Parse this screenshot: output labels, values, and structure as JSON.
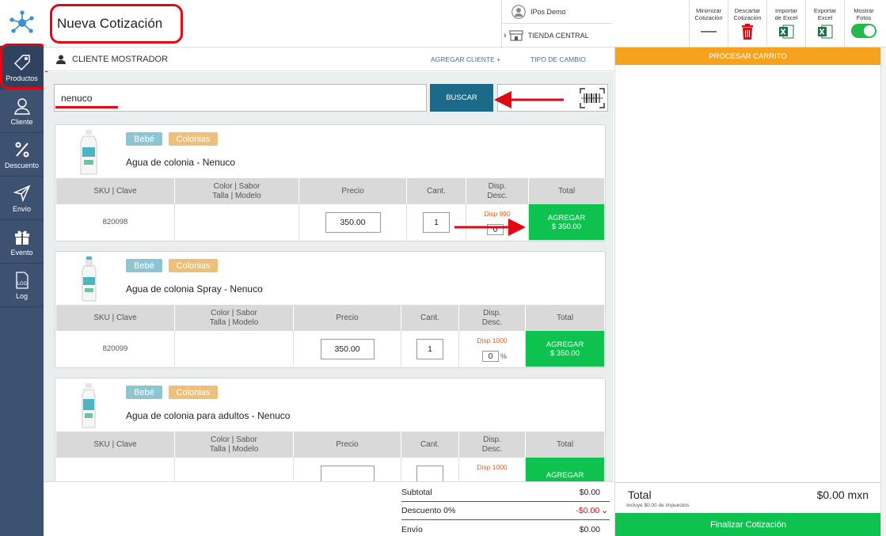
{
  "header": {
    "title": "Nueva Cotización",
    "user_name": "IPos Demo",
    "store_name": "TIENDA CENTRAL",
    "tools": [
      {
        "label_l1": "Minimizar",
        "label_l2": "Cotización"
      },
      {
        "label_l1": "Descartar",
        "label_l2": "Cotización"
      },
      {
        "label_l1": "Importar",
        "label_l2": "de Excel"
      },
      {
        "label_l1": "Exportar",
        "label_l2": "Excel"
      },
      {
        "label_l1": "Mostrar",
        "label_l2": "Fotos"
      }
    ]
  },
  "sidebar": {
    "items": [
      {
        "label": "Productos",
        "icon": "tag-icon"
      },
      {
        "label": "Cliente",
        "icon": "user-icon"
      },
      {
        "label": "Descuento",
        "icon": "percent-icon"
      },
      {
        "label": "Envío",
        "icon": "send-icon"
      },
      {
        "label": "Evento",
        "icon": "gift-icon"
      },
      {
        "label": "Log",
        "icon": "log-file-icon"
      }
    ],
    "log_icon_text": "LOG"
  },
  "subheader": {
    "client": "CLIENTE MOSTRADOR",
    "add_client": "AGREGAR CLIENTE +",
    "exchange_rate": "TIPO DE CAMBIO"
  },
  "search": {
    "value": "nenuco",
    "button": "BUSCAR"
  },
  "table_headers": {
    "sku": "SKU | Clave",
    "attr_l1": "Color | Sabor",
    "attr_l2": "Talla | Modelo",
    "price": "Precio",
    "qty": "Cant.",
    "disp_l1": "Disp.",
    "disp_l2": "Desc.",
    "total": "Total"
  },
  "products": [
    {
      "badge1": "Bebé",
      "badge2": "Colonias",
      "name": "Agua de colonia - Nenuco",
      "sku": "820098",
      "price": "350.00",
      "qty": "1",
      "disp": "Disp 990",
      "discount": "0",
      "pct": "%",
      "add_l1": "AGREGAR",
      "add_l2": "$ 350.00"
    },
    {
      "badge1": "Bebé",
      "badge2": "Colonias",
      "name": "Agua de colonia Spray - Nenuco",
      "sku": "820099",
      "price": "350.00",
      "qty": "1",
      "disp": "Disp 1000",
      "discount": "0",
      "pct": "%",
      "add_l1": "AGREGAR",
      "add_l2": "$ 350.00"
    },
    {
      "badge1": "Bebé",
      "badge2": "Colonias",
      "name": "Agua de colonia para adultos - Nenuco",
      "sku": "",
      "price": "",
      "qty": "",
      "disp": "Disp 1000",
      "discount": "",
      "pct": "",
      "add_l1": "AGREGAR",
      "add_l2": ""
    }
  ],
  "summary": {
    "subtotal_label": "Subtotal",
    "subtotal": "$0.00",
    "discount_label": "Descuento 0%",
    "discount": "-$0.00",
    "shipping_label": "Envío",
    "shipping": "$0.00"
  },
  "cart": {
    "process": "PROCESAR CARRITO",
    "total_label": "Total",
    "total_value": "$0.00 mxn",
    "taxes_note": "Incluye $0.00 de impuestos",
    "finalize": "Finalizar Cotización"
  },
  "colors": {
    "accent_green": "#0dc24e",
    "sidebar": "#3d5170",
    "search_button": "#1c6a8a",
    "process_bar": "#f5a21e",
    "annotation_red": "#e30613"
  }
}
